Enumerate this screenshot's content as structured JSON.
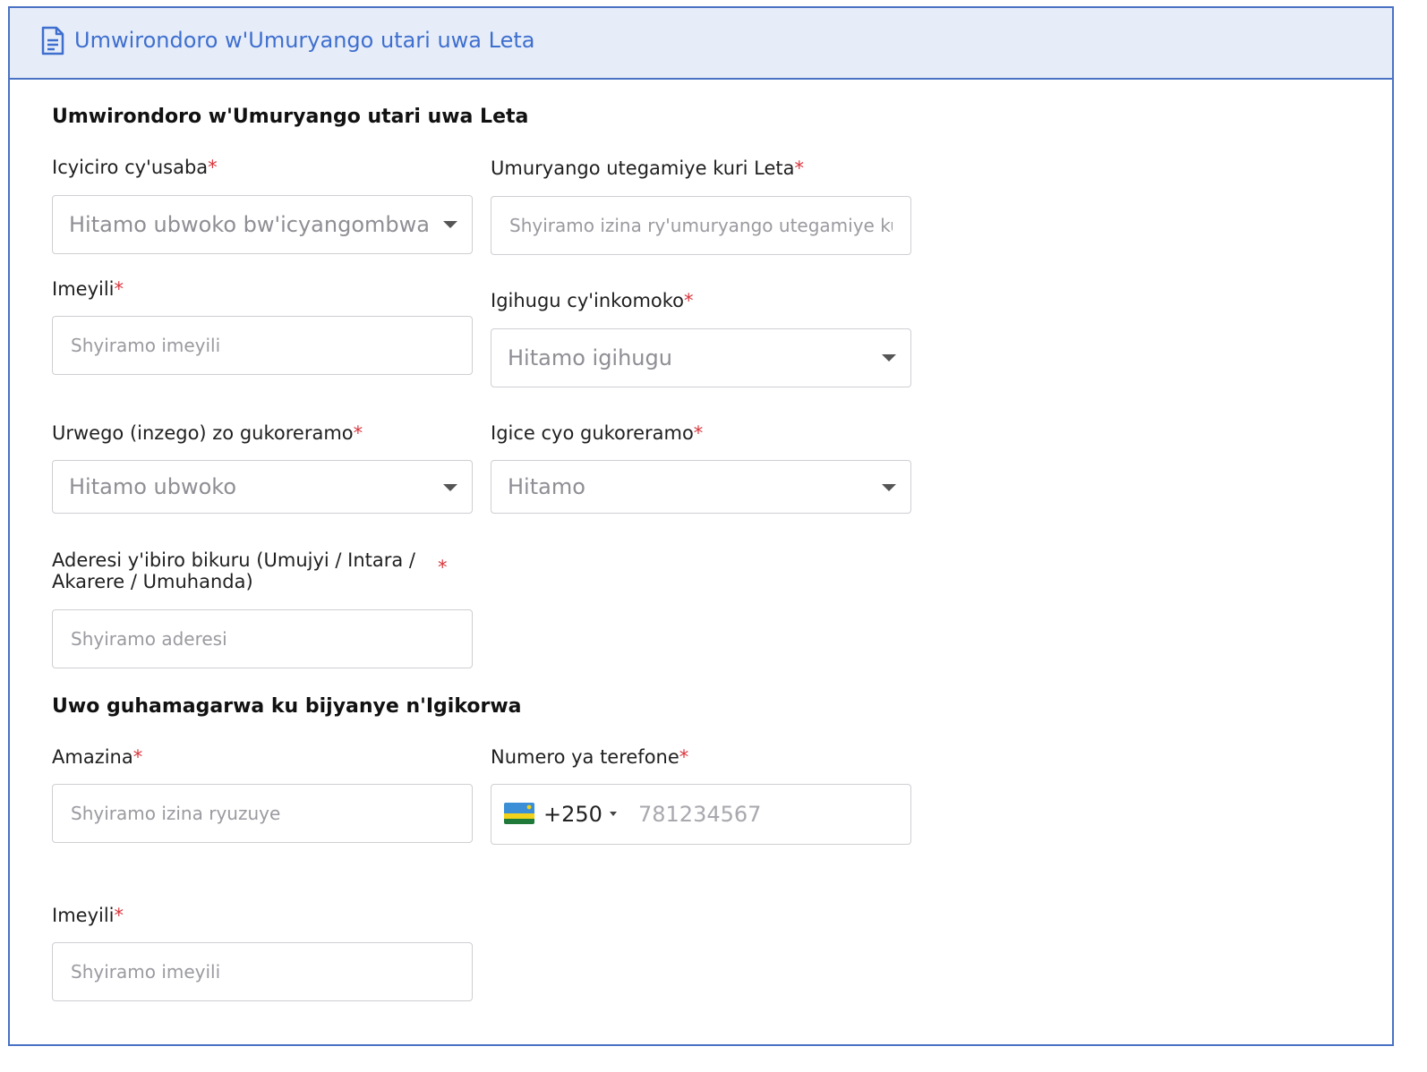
{
  "header": {
    "title": "Umwirondoro w'Umuryango utari uwa Leta",
    "icon": "document-icon"
  },
  "colors": {
    "accent": "#3f6fce",
    "border": "#4a72c4",
    "header_bg": "#e6edf9",
    "required": "#d9363e"
  },
  "section1": {
    "title": "Umwirondoro w'Umuryango utari uwa Leta",
    "category": {
      "label": "Icyiciro cy'usaba",
      "placeholder": "Hitamo ubwoko bw'icyangombwa"
    },
    "parent_org": {
      "label": "Umuryango utegamiye kuri Leta",
      "placeholder": "Shyiramo izina ry'umuryango utegamiye kuri Leta"
    },
    "email": {
      "label": "Imeyili",
      "placeholder": "Shyiramo imeyili"
    },
    "country": {
      "label": "Igihugu cy'inkomoko",
      "placeholder": "Hitamo igihugu"
    },
    "levels": {
      "label": "Urwego (inzego) zo gukoreramo",
      "placeholder": "Hitamo ubwoko"
    },
    "sector": {
      "label": "Igice cyo gukoreramo",
      "placeholder": "Hitamo"
    },
    "address": {
      "label_line1": "Aderesi y'ibiro bikuru (Umujyi / Intara /",
      "label_line2": "Akarere / Umuhanda)",
      "placeholder": "Shyiramo aderesi"
    }
  },
  "section2": {
    "title": "Uwo guhamagarwa ku bijyanye n'Igikorwa",
    "name": {
      "label": "Amazina",
      "placeholder": "Shyiramo izina ryuzuye"
    },
    "phone": {
      "label": "Numero ya terefone",
      "country_code": "+250",
      "placeholder": "781234567",
      "flag": "rwanda-flag-icon"
    },
    "email": {
      "label": "Imeyili",
      "placeholder": "Shyiramo imeyili"
    }
  },
  "required_mark": "*"
}
